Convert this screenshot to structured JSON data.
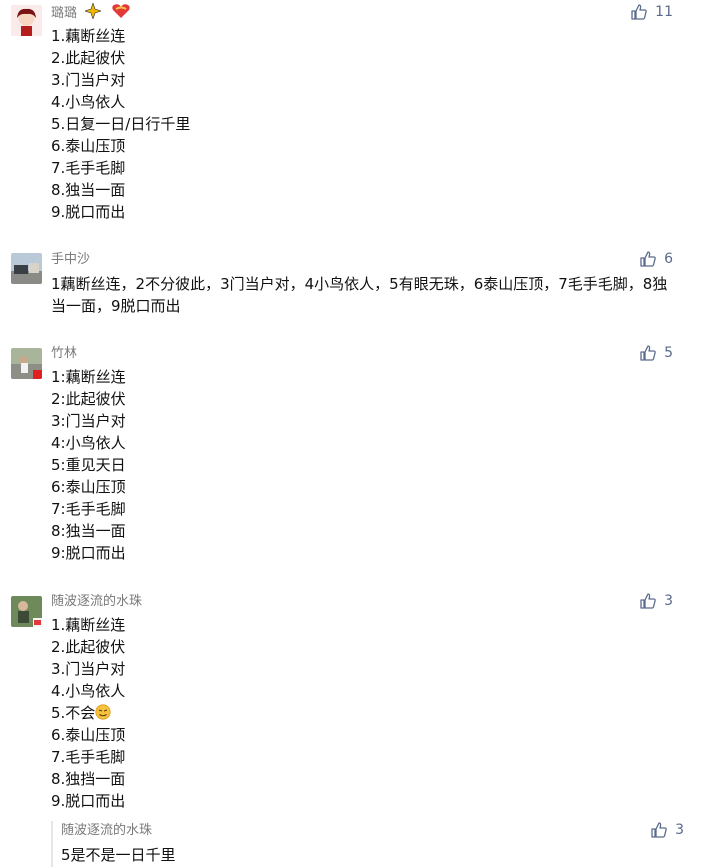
{
  "comments": [
    {
      "name": "璐璐",
      "likes": "11",
      "lines": [
        "1.藕断丝连",
        "2.此起彼伏",
        "3.门当户对",
        "4.小鸟依人",
        "5.日复一日/日行千里",
        "6.泰山压顶",
        "7.毛手毛脚",
        "8.独当一面",
        "9.脱口而出"
      ]
    },
    {
      "name": "手中沙",
      "likes": "6",
      "text": "1藕断丝连，2不分彼此，3门当户对，4小鸟依人，5有眼无珠，6泰山压顶，7毛手毛脚，8独当一面，9脱口而出"
    },
    {
      "name": "竹林",
      "likes": "5",
      "lines": [
        "1:藕断丝连",
        "2:此起彼伏",
        "3:门当户对",
        "4:小鸟依人",
        "5:重见天日",
        "6:泰山压顶",
        "7:毛手毛脚",
        "8:独当一面",
        "9:脱口而出"
      ]
    },
    {
      "name": "随波逐流的水珠",
      "likes": "3",
      "lines": [
        "1.藕断丝连",
        "2.此起彼伏",
        "3.门当户对",
        "4.小鸟依人",
        "5.不会",
        "6.泰山压顶",
        "7.毛手毛脚",
        "8.独挡一面",
        "9.脱口而出"
      ],
      "reply": {
        "name": "随波逐流的水珠",
        "likes": "3",
        "text": "5是不是一日千里"
      }
    }
  ],
  "colors": {
    "nickname": "#7a7a7a",
    "like": "#5a6a8c",
    "reply_border": "#e6e6e6"
  },
  "icons": [
    "thumbs-up-icon",
    "sparkle-icon",
    "heart-icon",
    "emoji-icon"
  ]
}
